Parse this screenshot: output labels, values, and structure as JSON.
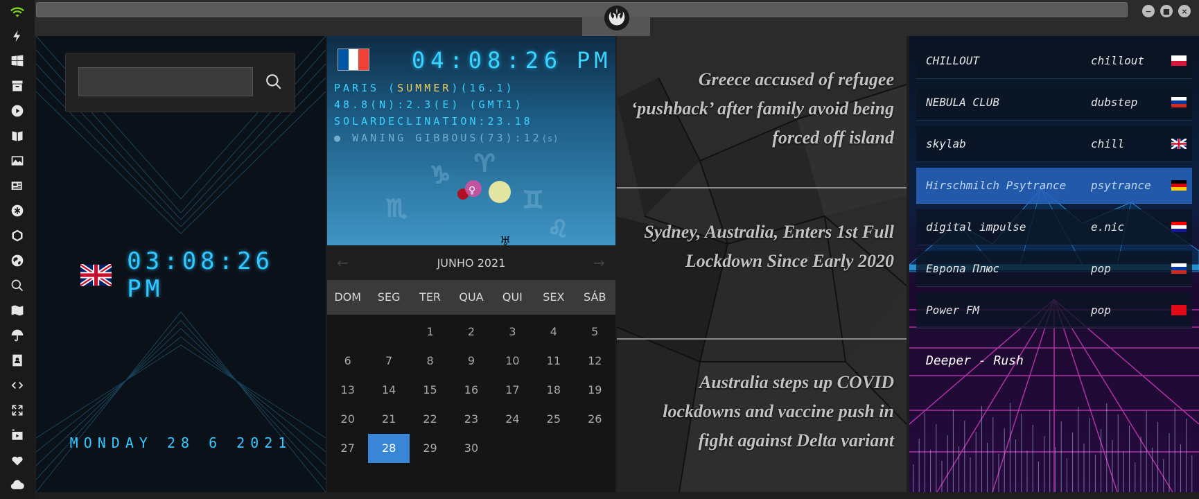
{
  "clock_panel": {
    "local_time": "03:08:26 PM",
    "date": "MONDAY 28 6 2021"
  },
  "world_clock": {
    "time": "04:08:26",
    "ampm": "PM",
    "city": "PARIS",
    "season": "SUMMER",
    "temp": "(16.1)",
    "coords": "48.8(N):2.3(E) (GMT1)",
    "solar": "SOLARDECLINATION:23.18",
    "moon": "WANING GIBBOUS(73):12",
    "moon_unit": "(s)"
  },
  "calendar": {
    "month_label": "JUNHO 2021",
    "weekdays": [
      "DOM",
      "SEG",
      "TER",
      "QUA",
      "QUI",
      "SEX",
      "SÁB"
    ],
    "weeks": [
      [
        "",
        "",
        "1",
        "2",
        "3",
        "4",
        "5"
      ],
      [
        "6",
        "7",
        "8",
        "9",
        "10",
        "11",
        "12"
      ],
      [
        "13",
        "14",
        "15",
        "16",
        "17",
        "18",
        "19"
      ],
      [
        "20",
        "21",
        "22",
        "23",
        "24",
        "25",
        "26"
      ],
      [
        "27",
        "28",
        "29",
        "30",
        "",
        "",
        ""
      ]
    ],
    "selected_day": "28"
  },
  "news": [
    "Greece accused of refugee ‘pushback’ after family avoid being forced off island",
    "Sydney, Australia, Enters 1st Full Lockdown Since Early 2020",
    "Australia steps up COVID lockdowns and vaccine push in fight against Delta variant"
  ],
  "radio": {
    "stations": [
      {
        "name": "CHILLOUT",
        "genre": "chillout",
        "flag": "poland"
      },
      {
        "name": "NEBULA CLUB",
        "genre": "dubstep",
        "flag": "russia"
      },
      {
        "name": "skylab",
        "genre": "chill",
        "flag": "uk"
      },
      {
        "name": "Hirschmilch Psytrance",
        "genre": "psytrance",
        "flag": "germany"
      },
      {
        "name": "digital impulse",
        "genre": "e.nic",
        "flag": "croatia"
      },
      {
        "name": "Европа Плюс",
        "genre": "pop",
        "flag": "russia"
      },
      {
        "name": "Power FM",
        "genre": "pop",
        "flag": "turkey"
      }
    ],
    "active_index": 3,
    "now_playing": "Deeper - Rush"
  },
  "colors": {
    "digital": "#33c8ff",
    "accent": "#3a86d6"
  }
}
